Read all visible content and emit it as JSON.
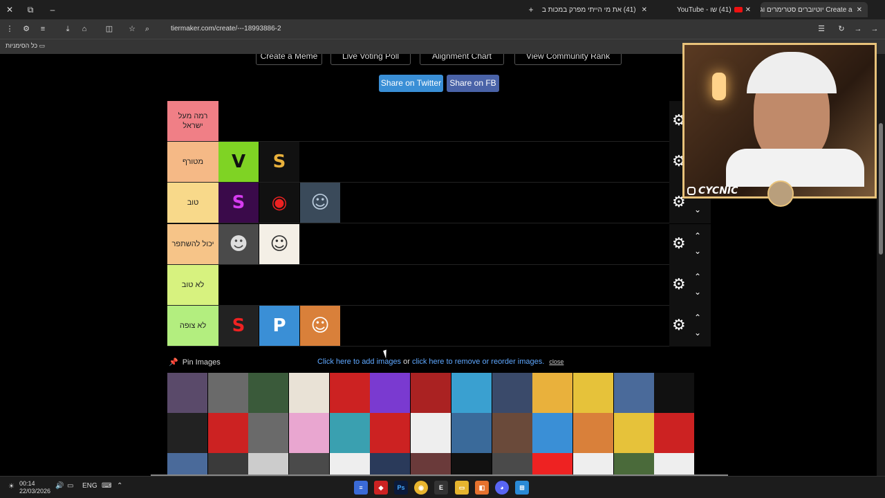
{
  "browser": {
    "tabs": [
      {
        "title": "Create a יוטיוברים סטרימרים וג",
        "active": true
      },
      {
        "title": "(41) שו - YouTube",
        "active": false
      },
      {
        "title": "(41) את מי הייתי מפרק במכות ב",
        "active": false
      }
    ],
    "url": "tiermaker.com/create/---18993886-2",
    "bookmarks_label": "כל הסימניות"
  },
  "page": {
    "top_buttons": [
      "Create a Meme",
      "Live Voting Poll",
      "Alignment Chart",
      "View Community Rank"
    ],
    "share_twitter": "Share on Twitter",
    "share_fb": "Share on FB",
    "tiers": [
      {
        "label": "רמה מעל ישראל",
        "color": "#f07f86",
        "items": []
      },
      {
        "label": "מטורף",
        "color": "#f5b986",
        "items": [
          {
            "glyph": "V",
            "bg": "#7fd324",
            "fg": "#111"
          },
          {
            "glyph": "S",
            "bg": "#111",
            "fg": "#e9b13c"
          }
        ]
      },
      {
        "label": "טוב",
        "color": "#f8d98a",
        "items": [
          {
            "glyph": "S",
            "bg": "#3a0a4a",
            "fg": "#d63cf0"
          },
          {
            "glyph": "◉",
            "bg": "#111",
            "fg": "#e22"
          },
          {
            "glyph": "☺",
            "bg": "#3a4a5a",
            "fg": "#bcd"
          }
        ]
      },
      {
        "label": "יכול להשתפר",
        "color": "#f6c488",
        "items": [
          {
            "glyph": "☻",
            "bg": "#4a4a4a",
            "fg": "#ddd"
          },
          {
            "glyph": "☺",
            "bg": "#f4efe6",
            "fg": "#333"
          }
        ]
      },
      {
        "label": "לא טוב",
        "color": "#d7f27f",
        "items": []
      },
      {
        "label": "לא צופה",
        "color": "#b3ee7f",
        "items": [
          {
            "glyph": "S",
            "bg": "#222",
            "fg": "#e22"
          },
          {
            "glyph": "P",
            "bg": "#3a8fd6",
            "fg": "#fff"
          },
          {
            "glyph": "☺",
            "bg": "#d9803a",
            "fg": "#fff"
          }
        ]
      }
    ],
    "pin_images": "Pin Images",
    "add_images": "Click here to add images",
    "or_text": " or ",
    "remove_images": "click here to remove or reorder images.",
    "close": "close",
    "pool_colors": [
      "#5a4a6a",
      "#6a6a6a",
      "#3a5a3a",
      "#e9e2d6",
      "#c22",
      "#7a3ad0",
      "#a22",
      "#3aa0d0",
      "#3a4a6a",
      "#e9b13c",
      "#e6c23a",
      "#4a6a9a",
      "#111",
      "#222",
      "#c22",
      "#6a6a6a",
      "#e9a6d0",
      "#3aa0b0",
      "#c22",
      "#eee",
      "#3a6a9a",
      "#6a4a3a",
      "#3a8fd6",
      "#d9803a",
      "#e6c23a",
      "#c22",
      "#4a6a9a",
      "#3a3a3a",
      "#ccc",
      "#4a4a4a",
      "#eee",
      "#2a3a5a",
      "#6a3a3a",
      "#111",
      "#4a4a4a",
      "#e22",
      "#eee",
      "#4a6a3a",
      "#eee"
    ],
    "webcam_name": "CYCNIC"
  },
  "taskbar": {
    "time": "00:14",
    "date": "22/03/2026",
    "lang": "ENG"
  }
}
